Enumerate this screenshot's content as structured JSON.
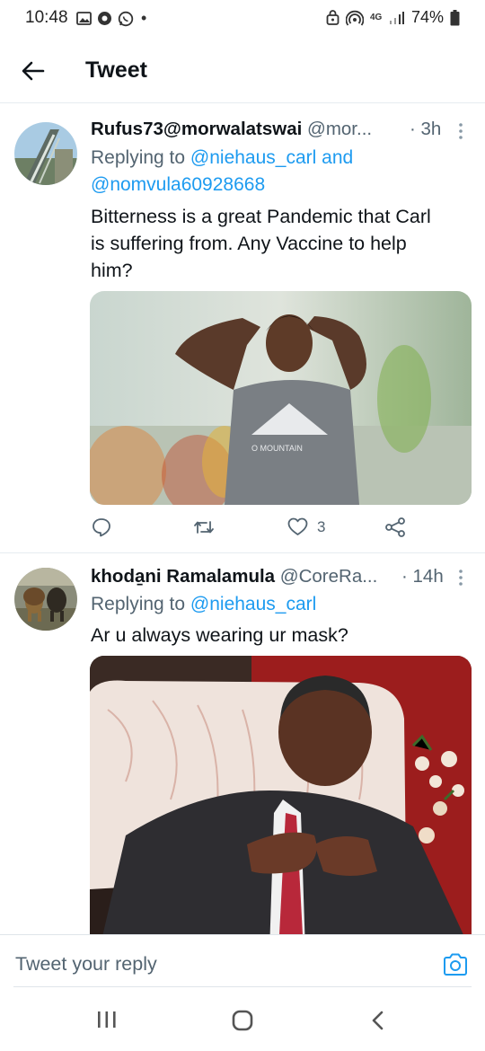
{
  "status_bar": {
    "time": "10:48",
    "battery": "74%",
    "network": "4G",
    "dot": "•"
  },
  "header": {
    "title": "Tweet"
  },
  "tweets": [
    {
      "name": "Rufus73@morwalatswai",
      "handle": "@mor...",
      "time": "· 3h",
      "replying_prefix": "Replying to",
      "replying_to_1": "@niehaus_carl and",
      "replying_to_2": "@nomvula60928668",
      "text_lines": [
        "Bitterness is a great Pandemic that Carl",
        "is suffering from. Any Vaccine to help",
        "him?"
      ],
      "likes": "3"
    },
    {
      "name": "khoda̱ni Ramalamula",
      "handle": "@CoreRa...",
      "time": "· 14h",
      "replying_prefix": "Replying to",
      "replying_to_1": "@niehaus_carl",
      "text_lines": [
        "Ar u always wearing ur mask?"
      ]
    }
  ],
  "reply_bar": {
    "placeholder": "Tweet your reply"
  },
  "icons": {
    "back": "arrow-left-icon",
    "more": "more-vertical-icon",
    "reply": "comment-icon",
    "retweet": "retweet-icon",
    "like": "heart-icon",
    "share": "share-icon",
    "camera": "camera-icon",
    "recents": "recents-icon",
    "home": "home-icon",
    "nav_back": "chevron-left-icon"
  },
  "colors": {
    "link": "#1d9bf0",
    "secondary": "#536471",
    "text": "#0f1419"
  }
}
